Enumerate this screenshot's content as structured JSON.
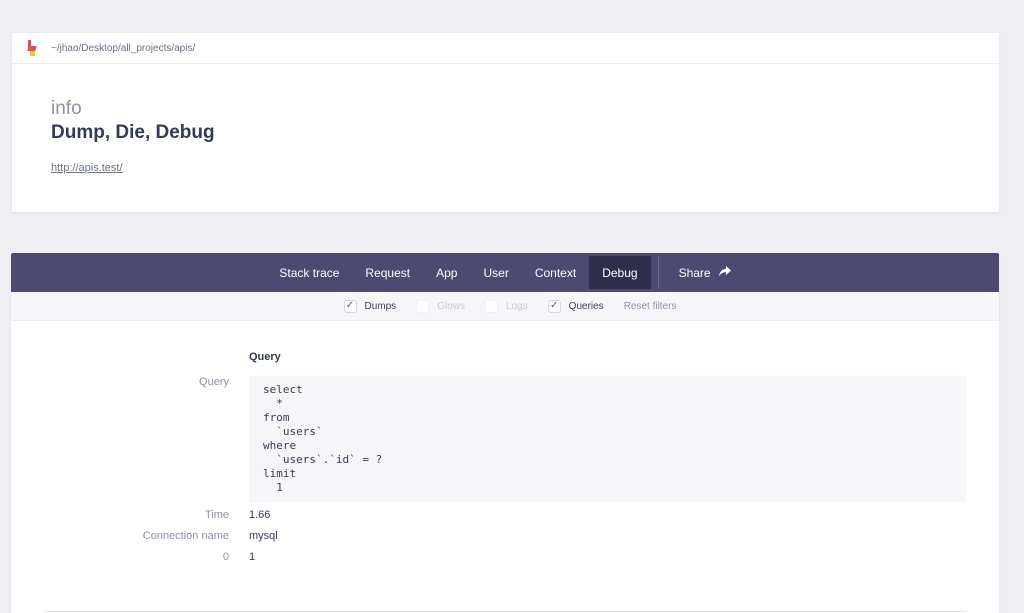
{
  "header": {
    "path": "~/jhao/Desktop/all_projects/apis/",
    "exception_class": "info",
    "exception_message": "Dump, Die, Debug",
    "url": "http://apis.test/"
  },
  "tabs": [
    {
      "label": "Stack trace"
    },
    {
      "label": "Request"
    },
    {
      "label": "App"
    },
    {
      "label": "User"
    },
    {
      "label": "Context"
    },
    {
      "label": "Debug",
      "active": true
    }
  ],
  "share": {
    "label": "Share",
    "icon": "share-arrow-icon"
  },
  "filters": [
    {
      "label": "Dumps",
      "checked": true,
      "enabled": true
    },
    {
      "label": "Glows",
      "checked": false,
      "enabled": false
    },
    {
      "label": "Logs",
      "checked": false,
      "enabled": false
    },
    {
      "label": "Queries",
      "checked": true,
      "enabled": true
    }
  ],
  "reset_filters": "Reset filters",
  "query_entry": {
    "heading": "Query",
    "query_label": "Query",
    "query_code": "select\n  *\nfrom\n  `users`\nwhere\n  `users`.`id` = ?\nlimit\n  1",
    "time_label": "Time",
    "time_value": "1.66",
    "connection_label": "Connection name",
    "connection_value": "mysql",
    "binding_label": "0",
    "binding_value": "1"
  },
  "colors": {
    "page_bg": "#eeeef3",
    "tabbar_bg": "#4c4a70",
    "active_tab_bg": "#2f2d4e",
    "checkbox_accent": "#5b3fd6",
    "logo_red": "#e64b5a",
    "logo_yellow": "#f4c430"
  }
}
